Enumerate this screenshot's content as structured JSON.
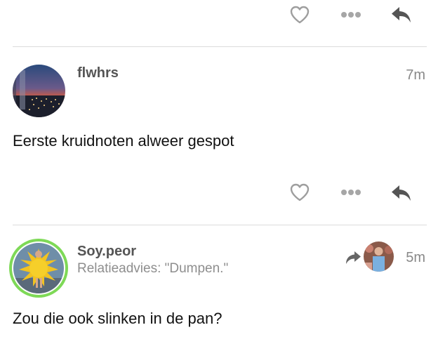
{
  "posts": [
    {
      "username": "flwhrs",
      "timestamp": "7m",
      "text": "Eerste kruidnoten alweer gespot",
      "avatar_icon": "city-night-photo"
    },
    {
      "username": "Soy.peor",
      "subtitle": "Relatieadvies: \"Dumpen.\"",
      "timestamp": "5m",
      "text": "Zou die ook slinken in de pan?",
      "avatar_icon": "sun-costume-photo",
      "avatar_ring_color": "#7ed957",
      "repost_avatar_icon": "person-photo"
    }
  ],
  "actions": {
    "like_icon": "heart-icon",
    "more_icon": "more-dots-icon",
    "reply_icon": "reply-icon",
    "repost_icon": "repost-arrow-icon"
  },
  "colors": {
    "icon_gray": "#9e9e9e",
    "reply_dark": "#555555",
    "divider": "#dcdcdc"
  }
}
